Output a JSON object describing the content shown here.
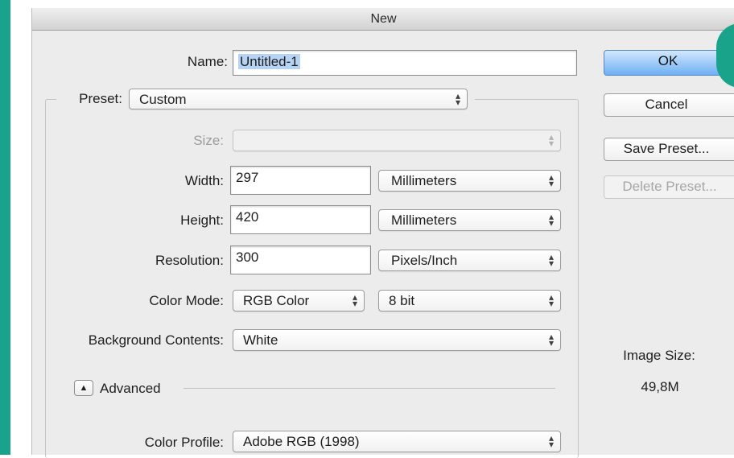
{
  "window": {
    "title": "New"
  },
  "fields": {
    "name_label": "Name:",
    "name_value": "Untitled-1",
    "preset_label": "Preset:",
    "preset_value": "Custom",
    "size_label": "Size:",
    "size_value": "",
    "width_label": "Width:",
    "width_value": "297",
    "width_unit": "Millimeters",
    "height_label": "Height:",
    "height_value": "420",
    "height_unit": "Millimeters",
    "resolution_label": "Resolution:",
    "resolution_value": "300",
    "resolution_unit": "Pixels/Inch",
    "color_mode_label": "Color Mode:",
    "color_mode_value": "RGB Color",
    "bit_depth_value": "8 bit",
    "background_label": "Background Contents:",
    "background_value": "White",
    "advanced_label": "Advanced",
    "color_profile_label": "Color Profile:",
    "color_profile_value": "Adobe RGB (1998)"
  },
  "buttons": {
    "ok": "OK",
    "cancel": "Cancel",
    "save_preset": "Save Preset...",
    "delete_preset": "Delete Preset..."
  },
  "image_size": {
    "label": "Image Size:",
    "value": "49,8M"
  },
  "icons": {
    "popup_arrows": "updown-arrows-icon",
    "advanced_toggle": "triangle-up-icon"
  },
  "colors": {
    "accent": "#1aa38b",
    "ok_button": "#6eb0f3",
    "selection": "#b6d3f4"
  }
}
